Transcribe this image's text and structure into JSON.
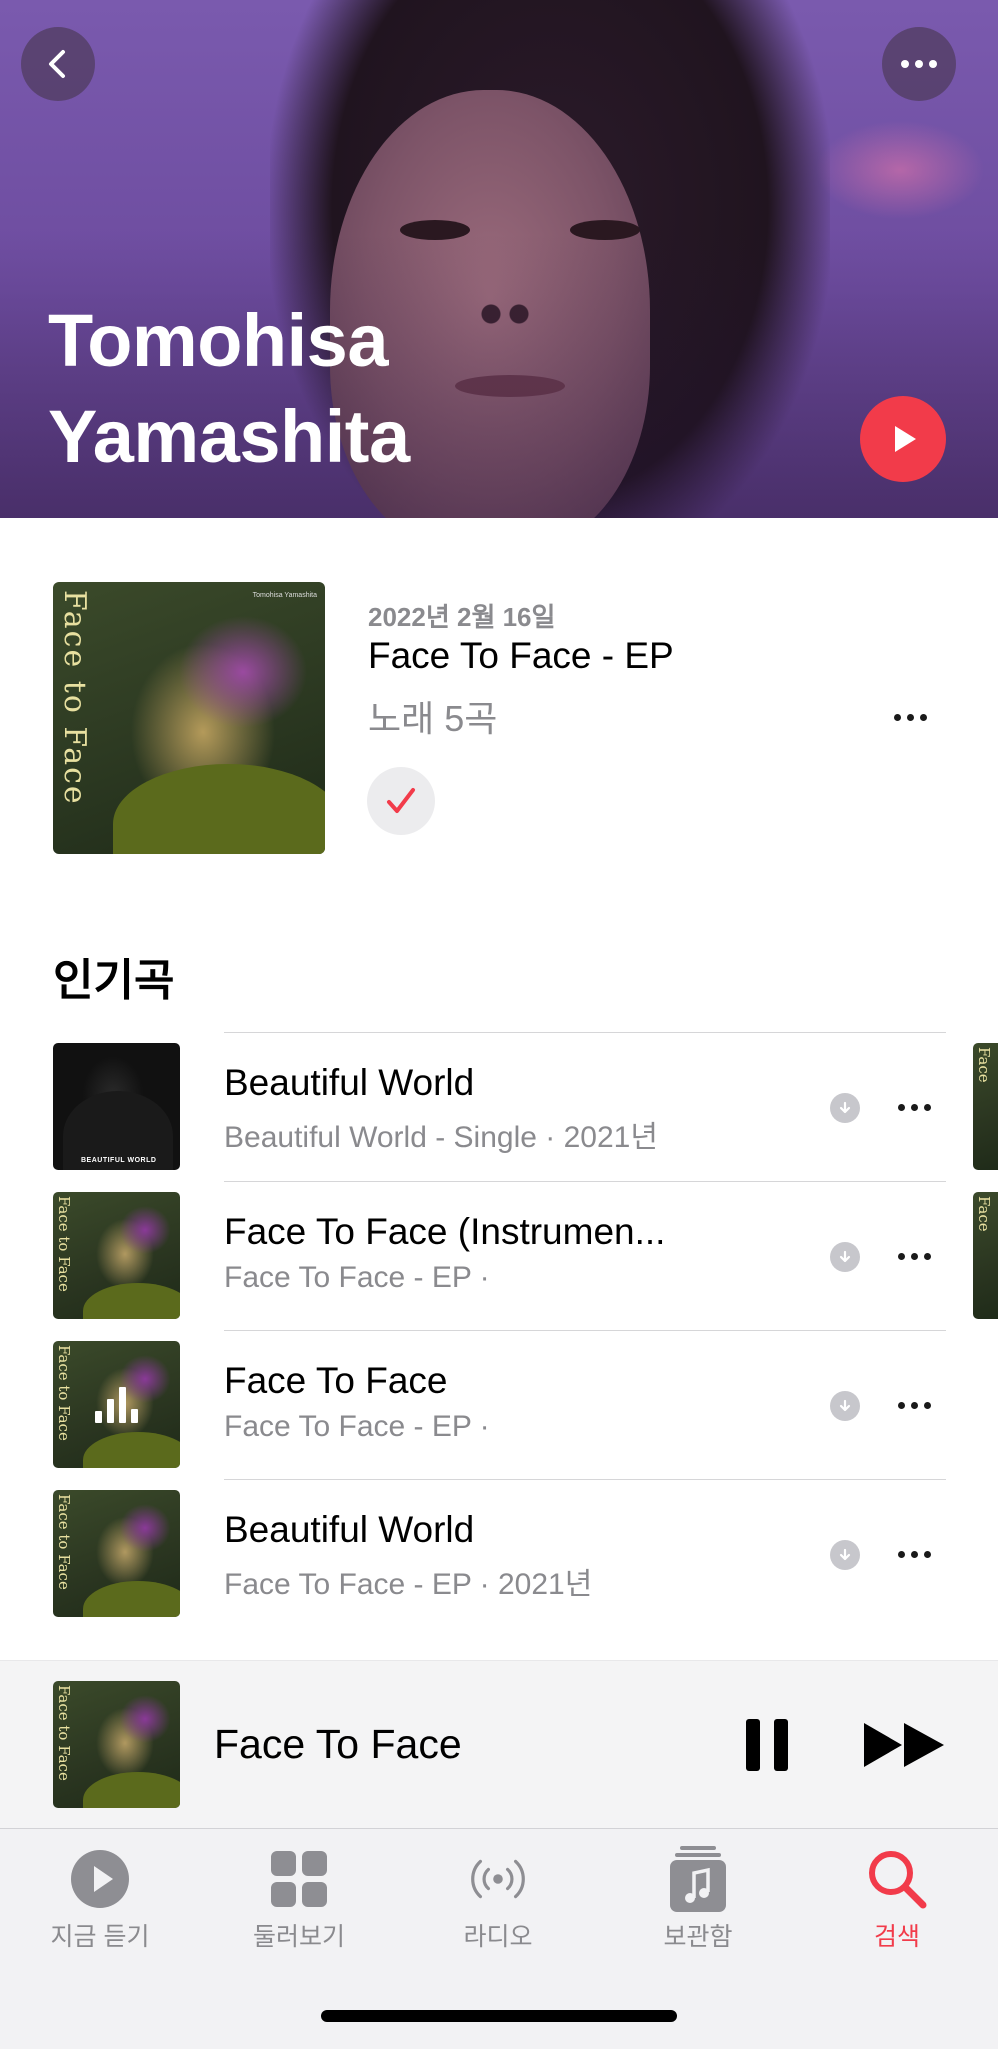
{
  "artist": {
    "name": "Tomohisa\nYamashita"
  },
  "header": {
    "back_icon": "chevron-left-icon",
    "more_icon": "ellipsis-icon",
    "play_icon": "play-icon"
  },
  "latest_release": {
    "date": "2022년 2월 16일",
    "title": "Face To Face - EP",
    "song_count": "노래 5곡",
    "art_text": "Face to Face",
    "art_credit": "Tomohisa Yamashita"
  },
  "top_songs": {
    "title": "인기곡",
    "items": [
      {
        "title": "Beautiful World",
        "subtitle": "Beautiful World - Single · 2021년",
        "art": "BEAUTIFUL WORLD"
      },
      {
        "title": "Face To Face (Instrumen...",
        "subtitle": "Face To Face - EP ·",
        "art": "Face to Face"
      },
      {
        "title": "Face To Face",
        "subtitle": "Face To Face - EP ·",
        "art": "Face to Face"
      },
      {
        "title": "Beautiful World",
        "subtitle": "Face To Face - EP · 2021년",
        "art": "Face to Face"
      }
    ]
  },
  "mini_player": {
    "title": "Face To Face",
    "art_text": "Face to Face"
  },
  "tabs": [
    {
      "label": "지금 듣기",
      "icon": "play-circle-icon"
    },
    {
      "label": "둘러보기",
      "icon": "grid-icon"
    },
    {
      "label": "라디오",
      "icon": "radio-icon"
    },
    {
      "label": "보관함",
      "icon": "library-icon"
    },
    {
      "label": "검색",
      "icon": "search-icon",
      "active": true
    }
  ],
  "colors": {
    "accent": "#f23b4a",
    "secondary_text": "#8a8a8e"
  }
}
